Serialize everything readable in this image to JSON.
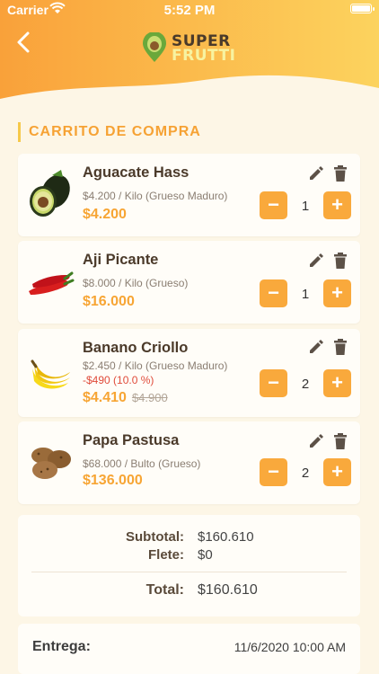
{
  "status_bar": {
    "carrier": "Carrier",
    "time": "5:52 PM"
  },
  "header": {
    "logo_line1": "SUPER",
    "logo_line2": "FRUTTI",
    "back_icon": "chevron-left-icon"
  },
  "section_title": "CARRITO DE COMPRA",
  "items": [
    {
      "name": "Aguacate Hass",
      "desc": "$4.200 / Kilo (Grueso Maduro)",
      "discount": "",
      "price": "$4.200",
      "old_price": "",
      "qty": "1",
      "image": "avocado"
    },
    {
      "name": "Aji Picante",
      "desc": "$8.000 / Kilo (Grueso)",
      "discount": "",
      "price": "$16.000",
      "old_price": "",
      "qty": "1",
      "image": "chili-peppers"
    },
    {
      "name": "Banano Criollo",
      "desc": "$2.450 / Kilo (Grueso Maduro)",
      "discount": "-$490 (10.0 %)",
      "price": "$4.410",
      "old_price": "$4.900",
      "qty": "2",
      "image": "bananas"
    },
    {
      "name": "Papa Pastusa",
      "desc": "$68.000 / Bulto (Grueso)",
      "discount": "",
      "price": "$136.000",
      "old_price": "",
      "qty": "2",
      "image": "potatoes"
    }
  ],
  "buttons": {
    "minus": "−",
    "plus": "+"
  },
  "summary": {
    "subtotal_label": "Subtotal:",
    "subtotal_value": "$160.610",
    "flete_label": "Flete:",
    "flete_value": "$0",
    "total_label": "Total:",
    "total_value": "$160.610"
  },
  "entrega": {
    "label": "Entrega:",
    "value": "11/6/2020 10:00 AM"
  },
  "colors": {
    "accent": "#f9a93c",
    "header_start": "#f9a13a",
    "header_end": "#fcd35e",
    "discount": "#e04b3a",
    "background": "#fdf6e6"
  }
}
